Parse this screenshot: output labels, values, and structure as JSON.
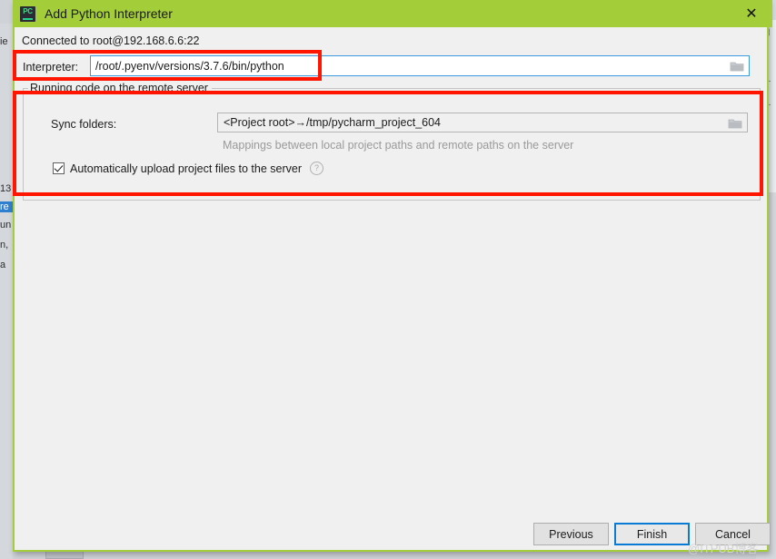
{
  "window": {
    "title": "Add Python Interpreter",
    "app_icon": "pycharm-icon",
    "app_icon_text": "PC",
    "close_icon": "✕",
    "titlebar_color": "#a4ce39"
  },
  "content": {
    "connection_status": "Connected to root@192.168.6.6:22",
    "interpreter": {
      "label": "Interpreter:",
      "value": "/root/.pyenv/versions/3.7.6/bin/python",
      "browse_icon": "folder-icon"
    },
    "remote_group": {
      "title": "Running code on the remote server",
      "sync_folders": {
        "label": "Sync folders:",
        "value": "<Project root>→/tmp/pycharm_project_604",
        "browse_icon": "folder-icon"
      },
      "mappings_hint": "Mappings between local project paths and remote paths on the server",
      "auto_upload": {
        "label": "Automatically upload project files to the server",
        "checked": true,
        "help_icon": "?"
      }
    }
  },
  "footer": {
    "previous_label": "Previous",
    "finish_label": "Finish",
    "cancel_label": "Cancel"
  },
  "annotations": {
    "highlight_color": "#ff1500",
    "box_interpreter": "interpreter-row-highlight",
    "box_remote_group": "remote-server-group-highlight"
  },
  "watermark": {
    "text": "@ITPUB博客"
  },
  "background": {
    "left_fragments": [
      "ie",
      "13",
      "re",
      "un",
      "n,",
      "a"
    ],
    "right_icons": [
      "▦",
      "—",
      "—",
      "▲",
      "●"
    ]
  }
}
